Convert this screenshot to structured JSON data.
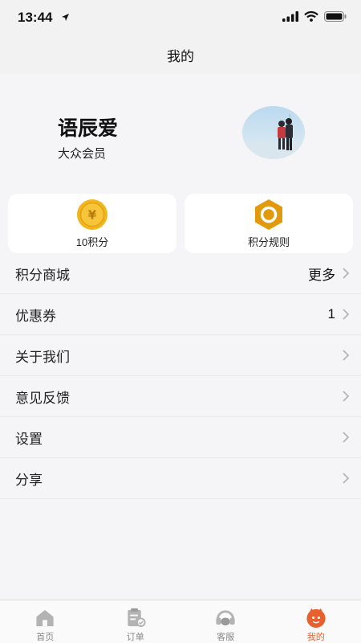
{
  "status": {
    "time": "13:44"
  },
  "nav": {
    "title": "我的"
  },
  "profile": {
    "name": "语辰爱",
    "level": "大众会员"
  },
  "cards": [
    {
      "label": "10积分",
      "icon": "coin-yen-icon"
    },
    {
      "label": "积分规则",
      "icon": "hexagon-ring-icon"
    }
  ],
  "menu": [
    {
      "label": "积分商城",
      "value": "更多"
    },
    {
      "label": "优惠券",
      "value": "1"
    },
    {
      "label": "关于我们",
      "value": ""
    },
    {
      "label": "意见反馈",
      "value": ""
    },
    {
      "label": "设置",
      "value": ""
    },
    {
      "label": "分享",
      "value": ""
    }
  ],
  "tabs": [
    {
      "label": "首页",
      "icon": "home-icon"
    },
    {
      "label": "订单",
      "icon": "order-icon"
    },
    {
      "label": "客服",
      "icon": "headset-icon"
    },
    {
      "label": "我的",
      "icon": "profile-face-icon",
      "active": true
    }
  ],
  "colors": {
    "accent": "#e8602d",
    "coin": "#f2b51c",
    "hexagon": "#e09a0c"
  }
}
